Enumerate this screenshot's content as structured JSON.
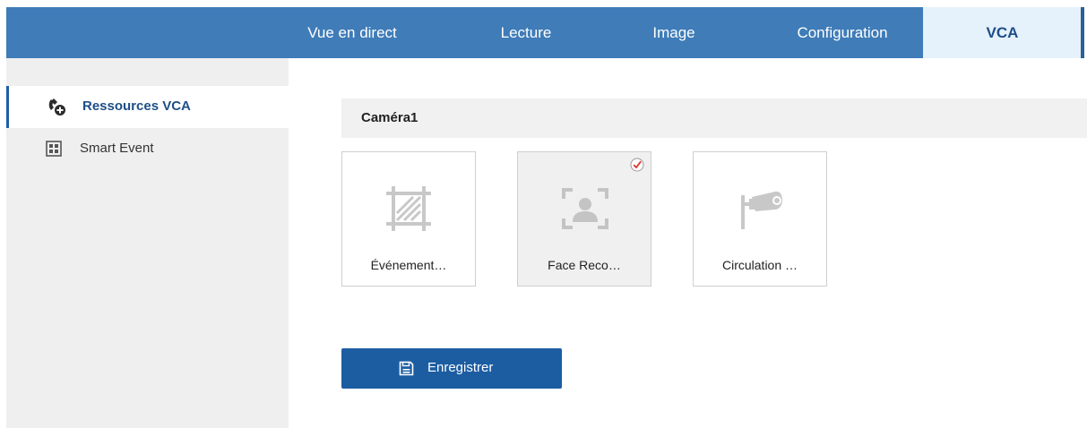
{
  "nav": {
    "tabs": [
      {
        "label": "Vue en direct"
      },
      {
        "label": "Lecture"
      },
      {
        "label": "Image"
      },
      {
        "label": "Configuration"
      },
      {
        "label": "VCA",
        "active": true
      }
    ]
  },
  "sidebar": {
    "items": [
      {
        "label": "Ressources VCA",
        "icon": "vca-resources-icon",
        "active": true
      },
      {
        "label": "Smart Event",
        "icon": "smart-event-icon"
      }
    ]
  },
  "main": {
    "camera_title": "Caméra1",
    "cards": [
      {
        "label": "Événement…",
        "icon": "event-area-icon"
      },
      {
        "label": "Face Reco…",
        "icon": "face-recognition-icon",
        "selected": true
      },
      {
        "label": "Circulation …",
        "icon": "traffic-camera-icon"
      }
    ],
    "save_label": "Enregistrer"
  },
  "colors": {
    "topbar": "#3f7cb8",
    "active_tab_bg": "#e5f1fb",
    "primary_button": "#1c5da2",
    "sidebar_bg": "#efefef",
    "check_red": "#e0322a"
  }
}
